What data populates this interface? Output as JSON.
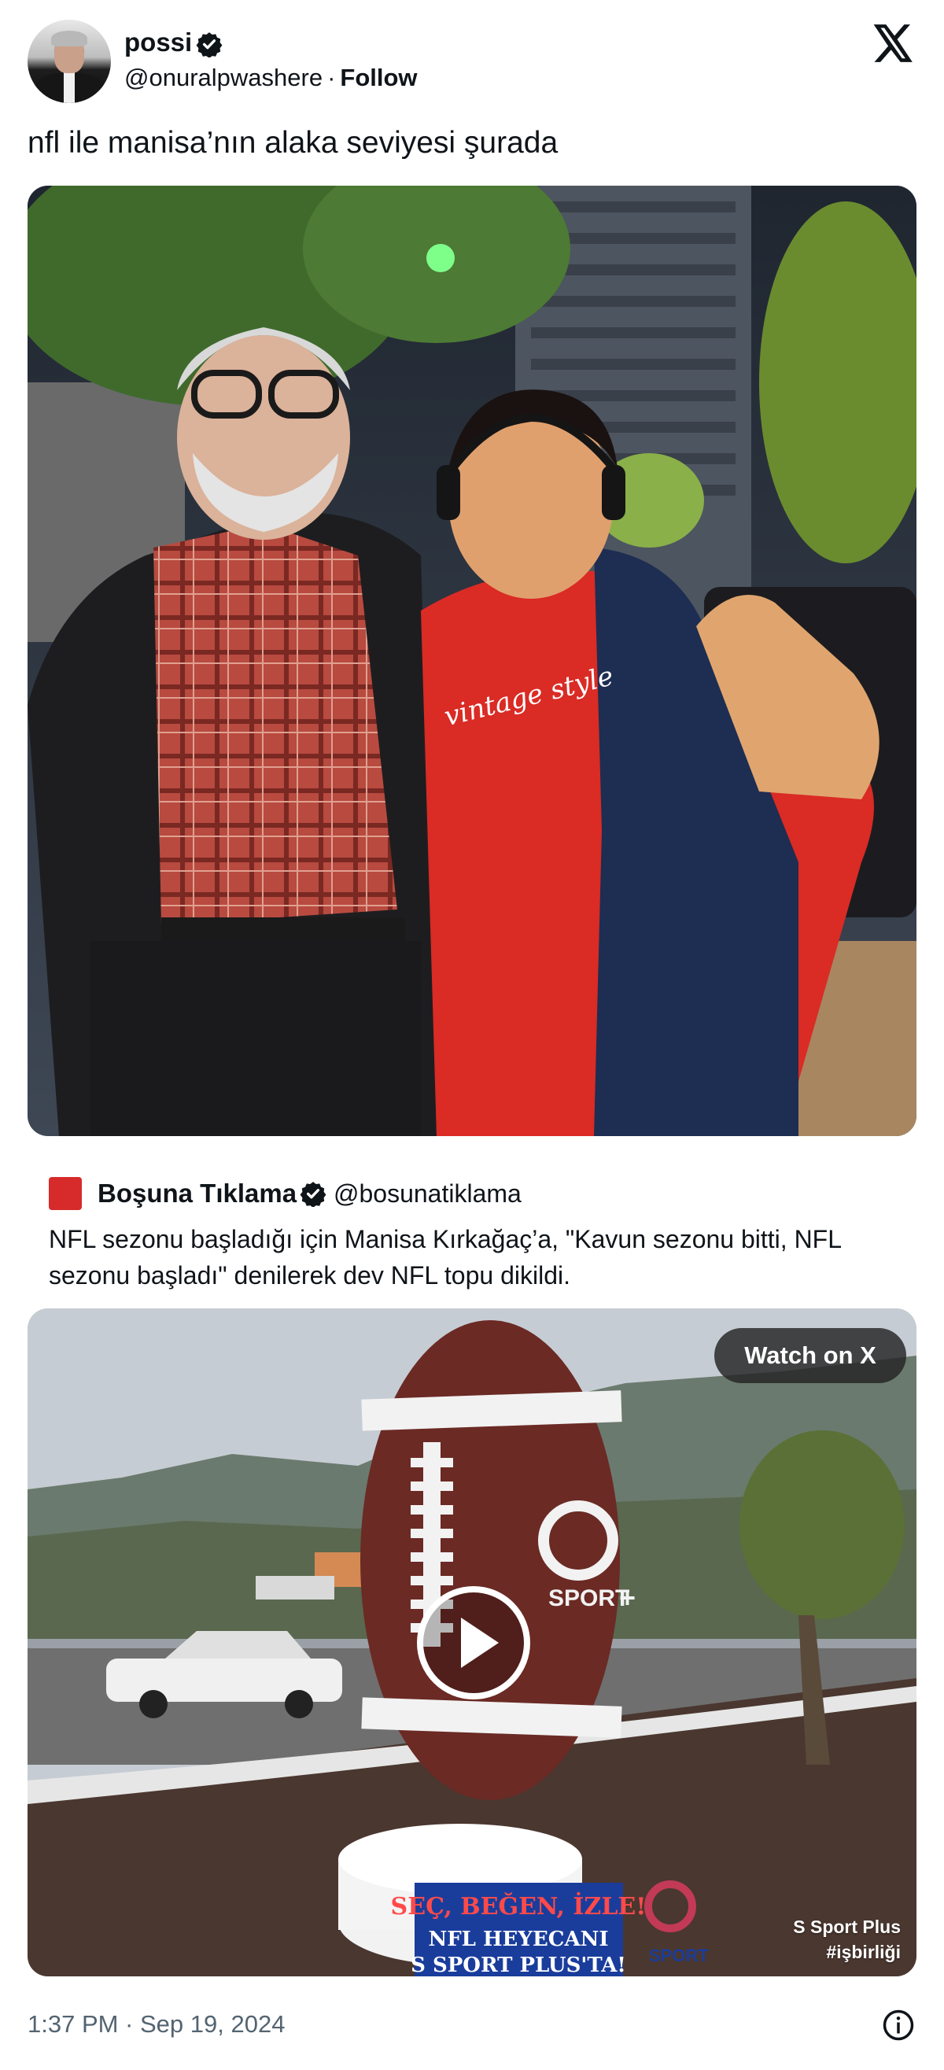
{
  "author": {
    "name": "possi",
    "handle": "@onuralpwashere",
    "separator": "·",
    "follow_label": "Follow"
  },
  "icons": {
    "verified": "verified-badge-icon",
    "brand": "x-logo-icon",
    "play": "play-icon",
    "info": "info-icon"
  },
  "tweet": {
    "text": "nfl ile manisa’nın alaka seviyesi şurada"
  },
  "photo": {
    "shirt_text": "vintage style"
  },
  "quote": {
    "name": "Boşuna Tıklama",
    "handle": "@bosunatiklama",
    "text": "NFL sezonu başladığı için Manisa Kırkağaç’a, \"Kavun sezonu bitti, NFL sezonu başladı\" denilerek dev NFL topu dikildi."
  },
  "video": {
    "watch_label": "Watch on X",
    "ball_brand": "SPORT",
    "ball_plus": "+",
    "base_line1": "SEÇ, BEĞEN, İZLE!",
    "base_line2": "NFL HEYECANI",
    "base_line3": "S SPORT PLUS'TA!",
    "base_logo": "SPORT",
    "watermark_line1": "S Sport Plus",
    "watermark_line2": "#işbirliği"
  },
  "footer": {
    "timestamp": "1:37 PM · Sep 19, 2024"
  },
  "colors": {
    "text": "#0f1419",
    "muted": "#536471",
    "verified": "#0f1419",
    "quote_logo": "#d72a2a",
    "base_sign": "#1a3d9c"
  }
}
